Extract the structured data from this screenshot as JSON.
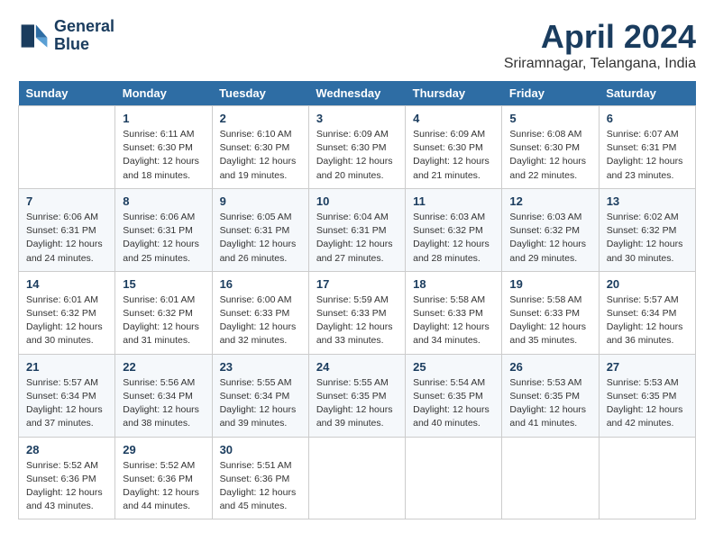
{
  "header": {
    "logo_line1": "General",
    "logo_line2": "Blue",
    "title": "April 2024",
    "subtitle": "Sriramnagar, Telangana, India"
  },
  "days_of_week": [
    "Sunday",
    "Monday",
    "Tuesday",
    "Wednesday",
    "Thursday",
    "Friday",
    "Saturday"
  ],
  "weeks": [
    [
      {
        "day": "",
        "sunrise": "",
        "sunset": "",
        "daylight": ""
      },
      {
        "day": "1",
        "sunrise": "Sunrise: 6:11 AM",
        "sunset": "Sunset: 6:30 PM",
        "daylight": "Daylight: 12 hours and 18 minutes."
      },
      {
        "day": "2",
        "sunrise": "Sunrise: 6:10 AM",
        "sunset": "Sunset: 6:30 PM",
        "daylight": "Daylight: 12 hours and 19 minutes."
      },
      {
        "day": "3",
        "sunrise": "Sunrise: 6:09 AM",
        "sunset": "Sunset: 6:30 PM",
        "daylight": "Daylight: 12 hours and 20 minutes."
      },
      {
        "day": "4",
        "sunrise": "Sunrise: 6:09 AM",
        "sunset": "Sunset: 6:30 PM",
        "daylight": "Daylight: 12 hours and 21 minutes."
      },
      {
        "day": "5",
        "sunrise": "Sunrise: 6:08 AM",
        "sunset": "Sunset: 6:30 PM",
        "daylight": "Daylight: 12 hours and 22 minutes."
      },
      {
        "day": "6",
        "sunrise": "Sunrise: 6:07 AM",
        "sunset": "Sunset: 6:31 PM",
        "daylight": "Daylight: 12 hours and 23 minutes."
      }
    ],
    [
      {
        "day": "7",
        "sunrise": "Sunrise: 6:06 AM",
        "sunset": "Sunset: 6:31 PM",
        "daylight": "Daylight: 12 hours and 24 minutes."
      },
      {
        "day": "8",
        "sunrise": "Sunrise: 6:06 AM",
        "sunset": "Sunset: 6:31 PM",
        "daylight": "Daylight: 12 hours and 25 minutes."
      },
      {
        "day": "9",
        "sunrise": "Sunrise: 6:05 AM",
        "sunset": "Sunset: 6:31 PM",
        "daylight": "Daylight: 12 hours and 26 minutes."
      },
      {
        "day": "10",
        "sunrise": "Sunrise: 6:04 AM",
        "sunset": "Sunset: 6:31 PM",
        "daylight": "Daylight: 12 hours and 27 minutes."
      },
      {
        "day": "11",
        "sunrise": "Sunrise: 6:03 AM",
        "sunset": "Sunset: 6:32 PM",
        "daylight": "Daylight: 12 hours and 28 minutes."
      },
      {
        "day": "12",
        "sunrise": "Sunrise: 6:03 AM",
        "sunset": "Sunset: 6:32 PM",
        "daylight": "Daylight: 12 hours and 29 minutes."
      },
      {
        "day": "13",
        "sunrise": "Sunrise: 6:02 AM",
        "sunset": "Sunset: 6:32 PM",
        "daylight": "Daylight: 12 hours and 30 minutes."
      }
    ],
    [
      {
        "day": "14",
        "sunrise": "Sunrise: 6:01 AM",
        "sunset": "Sunset: 6:32 PM",
        "daylight": "Daylight: 12 hours and 30 minutes."
      },
      {
        "day": "15",
        "sunrise": "Sunrise: 6:01 AM",
        "sunset": "Sunset: 6:32 PM",
        "daylight": "Daylight: 12 hours and 31 minutes."
      },
      {
        "day": "16",
        "sunrise": "Sunrise: 6:00 AM",
        "sunset": "Sunset: 6:33 PM",
        "daylight": "Daylight: 12 hours and 32 minutes."
      },
      {
        "day": "17",
        "sunrise": "Sunrise: 5:59 AM",
        "sunset": "Sunset: 6:33 PM",
        "daylight": "Daylight: 12 hours and 33 minutes."
      },
      {
        "day": "18",
        "sunrise": "Sunrise: 5:58 AM",
        "sunset": "Sunset: 6:33 PM",
        "daylight": "Daylight: 12 hours and 34 minutes."
      },
      {
        "day": "19",
        "sunrise": "Sunrise: 5:58 AM",
        "sunset": "Sunset: 6:33 PM",
        "daylight": "Daylight: 12 hours and 35 minutes."
      },
      {
        "day": "20",
        "sunrise": "Sunrise: 5:57 AM",
        "sunset": "Sunset: 6:34 PM",
        "daylight": "Daylight: 12 hours and 36 minutes."
      }
    ],
    [
      {
        "day": "21",
        "sunrise": "Sunrise: 5:57 AM",
        "sunset": "Sunset: 6:34 PM",
        "daylight": "Daylight: 12 hours and 37 minutes."
      },
      {
        "day": "22",
        "sunrise": "Sunrise: 5:56 AM",
        "sunset": "Sunset: 6:34 PM",
        "daylight": "Daylight: 12 hours and 38 minutes."
      },
      {
        "day": "23",
        "sunrise": "Sunrise: 5:55 AM",
        "sunset": "Sunset: 6:34 PM",
        "daylight": "Daylight: 12 hours and 39 minutes."
      },
      {
        "day": "24",
        "sunrise": "Sunrise: 5:55 AM",
        "sunset": "Sunset: 6:35 PM",
        "daylight": "Daylight: 12 hours and 39 minutes."
      },
      {
        "day": "25",
        "sunrise": "Sunrise: 5:54 AM",
        "sunset": "Sunset: 6:35 PM",
        "daylight": "Daylight: 12 hours and 40 minutes."
      },
      {
        "day": "26",
        "sunrise": "Sunrise: 5:53 AM",
        "sunset": "Sunset: 6:35 PM",
        "daylight": "Daylight: 12 hours and 41 minutes."
      },
      {
        "day": "27",
        "sunrise": "Sunrise: 5:53 AM",
        "sunset": "Sunset: 6:35 PM",
        "daylight": "Daylight: 12 hours and 42 minutes."
      }
    ],
    [
      {
        "day": "28",
        "sunrise": "Sunrise: 5:52 AM",
        "sunset": "Sunset: 6:36 PM",
        "daylight": "Daylight: 12 hours and 43 minutes."
      },
      {
        "day": "29",
        "sunrise": "Sunrise: 5:52 AM",
        "sunset": "Sunset: 6:36 PM",
        "daylight": "Daylight: 12 hours and 44 minutes."
      },
      {
        "day": "30",
        "sunrise": "Sunrise: 5:51 AM",
        "sunset": "Sunset: 6:36 PM",
        "daylight": "Daylight: 12 hours and 45 minutes."
      },
      {
        "day": "",
        "sunrise": "",
        "sunset": "",
        "daylight": ""
      },
      {
        "day": "",
        "sunrise": "",
        "sunset": "",
        "daylight": ""
      },
      {
        "day": "",
        "sunrise": "",
        "sunset": "",
        "daylight": ""
      },
      {
        "day": "",
        "sunrise": "",
        "sunset": "",
        "daylight": ""
      }
    ]
  ]
}
